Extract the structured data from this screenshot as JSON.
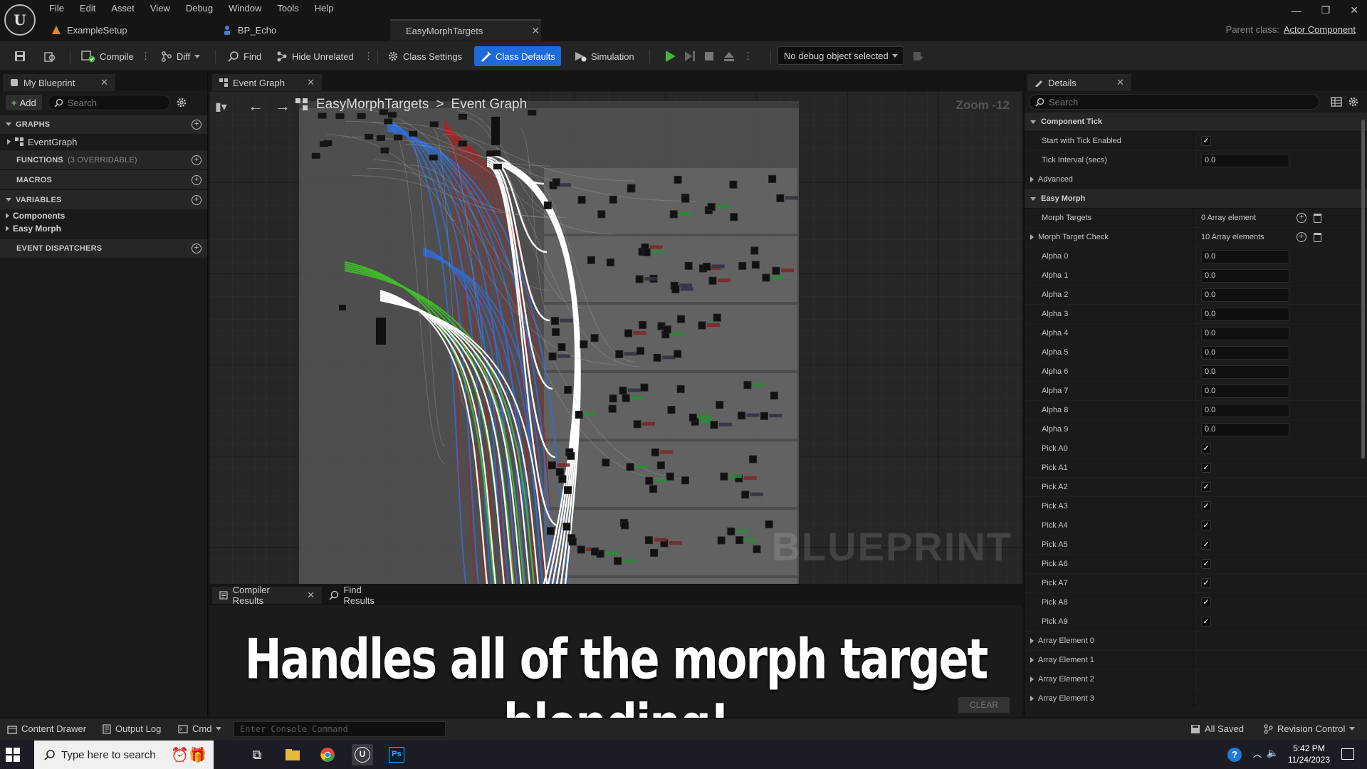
{
  "menu": [
    "File",
    "Edit",
    "Asset",
    "View",
    "Debug",
    "Window",
    "Tools",
    "Help"
  ],
  "doc_tabs": [
    {
      "label": "ExampleSetup",
      "icon": "level-icon"
    },
    {
      "label": "BP_Echo",
      "icon": "character-icon"
    },
    {
      "label": "EasyMorphTargets",
      "icon": "blueprint-icon",
      "active": true
    }
  ],
  "parent_class": {
    "label": "Parent class:",
    "value": "Actor Component"
  },
  "toolbar": {
    "compile": "Compile",
    "diff": "Diff",
    "find": "Find",
    "hide_unrelated": "Hide Unrelated",
    "class_settings": "Class Settings",
    "class_defaults": "Class Defaults",
    "simulation": "Simulation",
    "debug_object": "No debug object selected"
  },
  "my_blueprint": {
    "tab": "My Blueprint",
    "add": "Add",
    "search_placeholder": "Search",
    "sections": {
      "graphs": "GRAPHS",
      "functions": "FUNCTIONS",
      "functions_note": "(3 OVERRIDABLE)",
      "macros": "MACROS",
      "variables": "VARIABLES",
      "event_dispatchers": "EVENT DISPATCHERS"
    },
    "graph_items": [
      "EventGraph"
    ],
    "variable_items": [
      "Components",
      "Easy Morph"
    ]
  },
  "graph": {
    "tab": "Event Graph",
    "breadcrumb": [
      "EasyMorphTargets",
      "Event Graph"
    ],
    "zoom": "Zoom -12",
    "watermark": "BLUEPRINT"
  },
  "bottom": {
    "tabs": [
      "Compiler Results",
      "Find Results"
    ],
    "caption": "Handles all of the morph target blending!",
    "clear": "CLEAR"
  },
  "details": {
    "tab": "Details",
    "search_placeholder": "Search",
    "component_tick": "Component Tick",
    "start_with_tick": "Start with Tick Enabled",
    "tick_interval": "Tick Interval (secs)",
    "tick_interval_value": "0.0",
    "advanced": "Advanced",
    "easy_morph": "Easy Morph",
    "morph_targets": "Morph Targets",
    "morph_targets_value": "0 Array element",
    "morph_target_check": "Morph Target Check",
    "morph_target_check_value": "10 Array elements",
    "alphas": [
      {
        "name": "Alpha 0",
        "value": "0.0"
      },
      {
        "name": "Alpha 1",
        "value": "0.0"
      },
      {
        "name": "Alpha 2",
        "value": "0.0"
      },
      {
        "name": "Alpha 3",
        "value": "0.0"
      },
      {
        "name": "Alpha 4",
        "value": "0.0"
      },
      {
        "name": "Alpha 5",
        "value": "0.0"
      },
      {
        "name": "Alpha 6",
        "value": "0.0"
      },
      {
        "name": "Alpha 7",
        "value": "0.0"
      },
      {
        "name": "Alpha 8",
        "value": "0.0"
      },
      {
        "name": "Alpha 9",
        "value": "0.0"
      }
    ],
    "picks": [
      "Pick A0",
      "Pick A1",
      "Pick A2",
      "Pick A3",
      "Pick A4",
      "Pick A5",
      "Pick A6",
      "Pick A7",
      "Pick A8",
      "Pick A9"
    ],
    "array_elements": [
      "Array Element 0",
      "Array Element 1",
      "Array Element 2",
      "Array Element 3"
    ]
  },
  "statusbar": {
    "content_drawer": "Content Drawer",
    "output_log": "Output Log",
    "cmd": "Cmd",
    "console_placeholder": "Enter Console Command",
    "all_saved": "All Saved",
    "revision_control": "Revision Control"
  },
  "taskbar": {
    "search_placeholder": "Type here to search",
    "time": "5:42 PM",
    "date": "11/24/2023"
  },
  "colors": {
    "accent": "#1d6ad8",
    "exec_wire": "#ffffff",
    "wire_blue": "#2f6fd8",
    "wire_red": "#b02020",
    "wire_green": "#3fc02a"
  }
}
